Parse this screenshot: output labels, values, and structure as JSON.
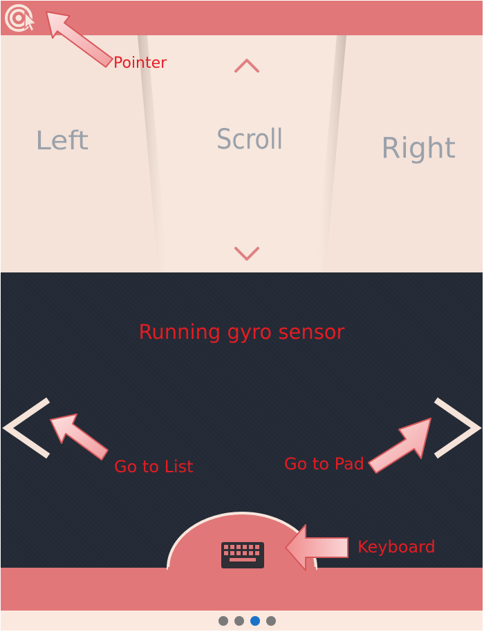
{
  "mouse_buttons": {
    "left": "Left",
    "scroll": "Scroll",
    "right": "Right"
  },
  "status": {
    "message": "Running  gyro sensor"
  },
  "annotations": {
    "pointer": "Pointer",
    "go_to_list": "Go to List",
    "go_to_pad": "Go to Pad",
    "keyboard": "Keyboard"
  },
  "icons": {
    "pointer": "target-cursor-icon",
    "scroll_up": "chevron-up-icon",
    "scroll_down": "chevron-down-icon",
    "nav_left": "chevron-left-icon",
    "nav_right": "chevron-right-icon",
    "keyboard": "keyboard-icon"
  },
  "pager": {
    "pages": 4,
    "current": 3
  },
  "colors": {
    "accent": "#e17779",
    "panel": "#f7e6dc",
    "dark_background": "#232a35",
    "annotation": "#e51c23",
    "dot_active": "#1a73c8",
    "dot_inactive": "#7a7a7a"
  }
}
